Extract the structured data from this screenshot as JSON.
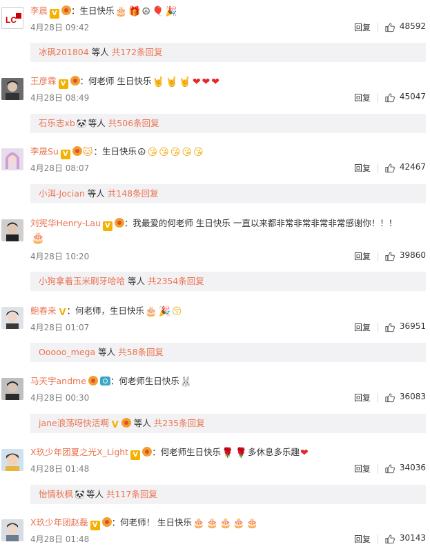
{
  "comments": [
    {
      "name": "李晨",
      "text": "：生日快乐",
      "date": "4月28日 09:42",
      "reply": "回复",
      "likes": "48592",
      "thread": {
        "names": "冰砜201804",
        "suffix": "等人",
        "count": "共172条回复"
      }
    },
    {
      "name": "王彦霖",
      "text": "：何老师 生日快乐",
      "date": "4月28日 08:49",
      "reply": "回复",
      "likes": "45047",
      "thread": {
        "names": "石乐志xb",
        "suffix": "等人",
        "count": "共506条回复"
      }
    },
    {
      "name": "李晟Su",
      "text": "：生日快乐",
      "date": "4月28日 08:07",
      "reply": "回复",
      "likes": "42467",
      "thread": {
        "names": "小洱-Jocian",
        "suffix": "等人",
        "count": "共148条回复"
      }
    },
    {
      "name": "刘宪华Henry-Lau",
      "text": "：我最爱的何老师 生日快乐  一直以来都非常非常非常非常感谢你！！！",
      "date": "4月28日 10:20",
      "reply": "回复",
      "likes": "39860",
      "thread": {
        "names": "小狗拿着玉米刷牙哈哈",
        "suffix": "等人",
        "count": "共2354条回复"
      }
    },
    {
      "name": "鲍春来",
      "text": "：何老师，生日快乐",
      "date": "4月28日 01:07",
      "reply": "回复",
      "likes": "36951",
      "thread": {
        "names": "Ooooo_mega",
        "suffix": "等人",
        "count": "共58条回复"
      }
    },
    {
      "name": "马天宇andme",
      "text": "：何老师生日快乐",
      "date": "4月28日 00:30",
      "reply": "回复",
      "likes": "36083",
      "thread": {
        "names": "jane浪荡呀快活啊",
        "suffix": "等人",
        "count": "共235条回复"
      }
    },
    {
      "name": "X玖少年团夏之光X_Light",
      "text": "：何老师生日快乐",
      "text2": "多休息多乐趣",
      "date": "4月28日 01:48",
      "reply": "回复",
      "likes": "34036",
      "thread": {
        "names": "怡情秋枫",
        "suffix": "等人",
        "count": "共117条回复"
      }
    },
    {
      "name": "X玖少年团赵磊",
      "text": "：何老师！ 生日快乐",
      "date": "4月28日 01:48",
      "reply": "回复",
      "likes": "30143"
    }
  ],
  "colors": {
    "username": "#eb7350",
    "meta": "#808080",
    "thread_bg": "#f2f2f5",
    "vip_badge": "#f5b000"
  },
  "icons": {
    "like": "thumbs-up-icon",
    "verified": "verified-v-badge",
    "emoji_cake": "cake-emoji"
  }
}
